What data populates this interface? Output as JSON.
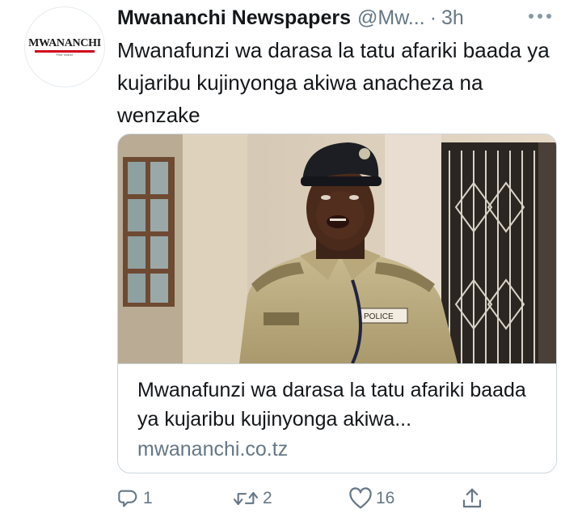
{
  "tweet": {
    "avatar": {
      "logo_text": "MWANANCHI",
      "tagline": "Pilot 'inland'"
    },
    "author": {
      "name": "Mwananchi Newspapers",
      "handle": "@Mw...",
      "separator": "·",
      "time": "3h"
    },
    "more_icon": "more-dots-icon",
    "text": "Mwanafunzi wa darasa la tatu afariki baada ya kujaribu kujinyonga akiwa anacheza na wenzake",
    "card": {
      "image_alt": "police officer photo",
      "title": "Mwanafunzi wa darasa la tatu afariki baada ya kujaribu kujinyonga akiwa...",
      "domain": "mwananchi.co.tz"
    },
    "actions": {
      "reply": {
        "icon": "reply-icon",
        "count": "1"
      },
      "retweet": {
        "icon": "retweet-icon",
        "count": "2"
      },
      "like": {
        "icon": "heart-icon",
        "count": "16"
      },
      "share": {
        "icon": "share-icon"
      }
    }
  },
  "colors": {
    "text": "#14171a",
    "secondary": "#657786",
    "border": "#ccd6dd",
    "brand_red": "#d0021b"
  }
}
